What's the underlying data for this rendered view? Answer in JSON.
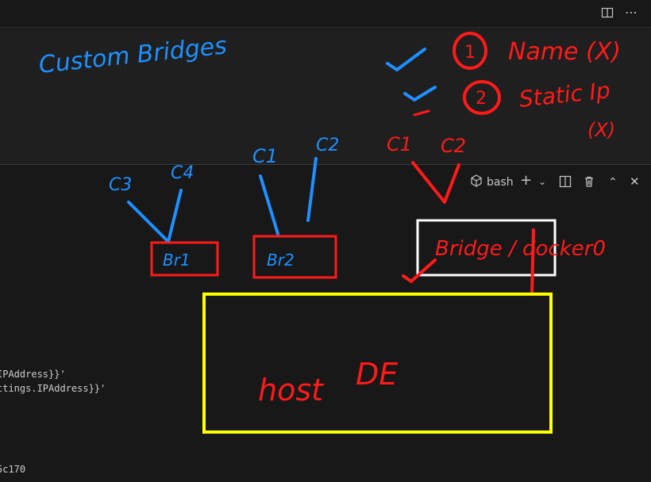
{
  "editor": {
    "split_icon": "split-editor-icon",
    "more_icon": "ellipsis-icon"
  },
  "terminal": {
    "shell_label": "bash",
    "icons": [
      "terminal-icon",
      "plus-icon",
      "chevron-down-icon",
      "split-terminal-icon",
      "trash-icon",
      "chevron-up-icon",
      "close-icon"
    ],
    "lines": [
      "IPAddress}}'",
      "ttings.IPAddress}}'",
      "5c170"
    ]
  },
  "annotations": {
    "heading": "Custom Bridges",
    "item1_num": "1",
    "item1_text": "Name (X)",
    "item2_num": "2",
    "item2_text": "Static Ip",
    "item2_mark": "(X)",
    "c1_left": "C1",
    "c2_left": "C2",
    "c1_right": "C1",
    "c2_right": "C2",
    "c3": "C3",
    "c4": "C4",
    "br1": "Br1",
    "br2": "Br2",
    "bridge": "Bridge / docker0",
    "host": "host",
    "de": "DE"
  },
  "colors": {
    "blue": "#1e90ff",
    "red": "#ff1a1a",
    "yellow": "#ffff00",
    "white": "#ffffff"
  }
}
